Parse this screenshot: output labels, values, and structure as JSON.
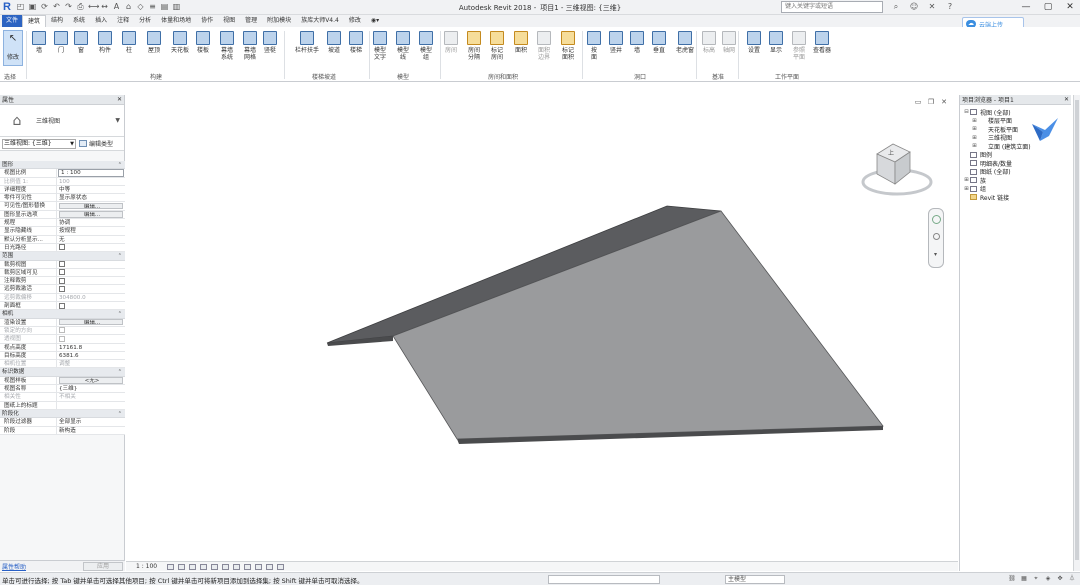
{
  "titlebar": {
    "logo": "R",
    "app": "Autodesk Revit 2018 -",
    "project": "项目1 - 三维视图: {三维}",
    "search_placeholder": "键入关键字或短语"
  },
  "tabs": [
    "文件",
    "建筑",
    "结构",
    "系统",
    "插入",
    "注释",
    "分析",
    "体量和场地",
    "协作",
    "视图",
    "管理",
    "附加模块",
    "族库大师V4.4",
    "修改"
  ],
  "cloud_button": "云端上传",
  "ribbon": {
    "modify": "修改",
    "select_label": "选择",
    "build_panel": "构建",
    "stair_panel": "楼梯坡道",
    "model_panel": "模型",
    "room_panel": "房间和面积",
    "opening_panel": "洞口",
    "datum_panel": "基准",
    "workplane_panel": "工作平面",
    "buttons": [
      {
        "label": "墙",
        "style": "blue"
      },
      {
        "label": "门",
        "style": "blue"
      },
      {
        "label": "窗",
        "style": "blue"
      },
      {
        "label": "构件",
        "style": "blue"
      },
      {
        "label": "柱",
        "style": "blue"
      },
      {
        "label": "屋顶",
        "style": "blue"
      },
      {
        "label": "天花板",
        "style": "blue"
      },
      {
        "label": "楼板",
        "style": "blue"
      },
      {
        "label": "幕墙\n系统",
        "style": "blue"
      },
      {
        "label": "幕墙\n网格",
        "style": "blue"
      },
      {
        "label": "竖梃",
        "style": "blue"
      },
      {
        "label": "栏杆扶手",
        "style": "blue"
      },
      {
        "label": "坡道",
        "style": "blue"
      },
      {
        "label": "楼梯",
        "style": "blue"
      },
      {
        "label": "模型\n文字",
        "style": "blue"
      },
      {
        "label": "模型\n线",
        "style": "blue"
      },
      {
        "label": "模型\n组",
        "style": "blue"
      },
      {
        "label": "房间",
        "style": "gray",
        "dim": true
      },
      {
        "label": "房间\n分隔",
        "style": "orange"
      },
      {
        "label": "标记\n房间",
        "style": "orange"
      },
      {
        "label": "面积",
        "style": "orange"
      },
      {
        "label": "面积\n边界",
        "style": "gray",
        "dim": true
      },
      {
        "label": "标记\n面积",
        "style": "orange"
      },
      {
        "label": "按\n面",
        "style": "blue"
      },
      {
        "label": "竖井",
        "style": "blue"
      },
      {
        "label": "墙",
        "style": "blue"
      },
      {
        "label": "垂直",
        "style": "blue"
      },
      {
        "label": "老虎窗",
        "style": "blue"
      },
      {
        "label": "标高",
        "style": "gray",
        "dim": true
      },
      {
        "label": "轴网",
        "style": "gray",
        "dim": true
      },
      {
        "label": "设置",
        "style": "blue"
      },
      {
        "label": "显示",
        "style": "blue"
      },
      {
        "label": "参照\n平面",
        "style": "gray",
        "dim": true
      },
      {
        "label": "查看器",
        "style": "blue"
      }
    ]
  },
  "properties": {
    "title": "属性",
    "close": "✕",
    "type_name": "三维视图",
    "view_selector": "三维视图: {三维}",
    "edit_type": "编辑类型",
    "groups": [
      {
        "name": "图形",
        "rows": [
          {
            "k": "视图比例",
            "v": "1 : 100",
            "kind": "input"
          },
          {
            "k": "比例值 1:",
            "v": "100",
            "dim": true
          },
          {
            "k": "详细程度",
            "v": "中等"
          },
          {
            "k": "零件可见性",
            "v": "显示原状态"
          },
          {
            "k": "可见性/图形替换",
            "v": "编辑...",
            "kind": "btn"
          },
          {
            "k": "图形显示选项",
            "v": "编辑...",
            "kind": "btn"
          },
          {
            "k": "规程",
            "v": "协调"
          },
          {
            "k": "显示隐藏线",
            "v": "按规程"
          },
          {
            "k": "默认分析显示...",
            "v": "无"
          },
          {
            "k": "日光路径",
            "v": "",
            "kind": "chk"
          }
        ]
      },
      {
        "name": "范围",
        "rows": [
          {
            "k": "裁剪视图",
            "v": "",
            "kind": "chk"
          },
          {
            "k": "裁剪区域可见",
            "v": "",
            "kind": "chk"
          },
          {
            "k": "注释裁剪",
            "v": "",
            "kind": "chk"
          },
          {
            "k": "远剪裁激活",
            "v": "",
            "kind": "chk"
          },
          {
            "k": "远剪裁偏移",
            "v": "304800.0",
            "dim": true
          },
          {
            "k": "剖面框",
            "v": "",
            "kind": "chk"
          }
        ]
      },
      {
        "name": "相机",
        "rows": [
          {
            "k": "渲染设置",
            "v": "编辑...",
            "kind": "btn"
          },
          {
            "k": "锁定的方向",
            "v": "",
            "kind": "chk",
            "dim": true
          },
          {
            "k": "透视图",
            "v": "",
            "kind": "chk",
            "dim": true
          },
          {
            "k": "视点高度",
            "v": "17161.8"
          },
          {
            "k": "目标高度",
            "v": "6381.6"
          },
          {
            "k": "相机位置",
            "v": "调整",
            "dim": true
          }
        ]
      },
      {
        "name": "标识数据",
        "rows": [
          {
            "k": "视图样板",
            "v": "<无>",
            "kind": "btn"
          },
          {
            "k": "视图名称",
            "v": "{三维}"
          },
          {
            "k": "相关性",
            "v": "不相关",
            "dim": true
          },
          {
            "k": "图纸上的标题",
            "v": ""
          }
        ]
      },
      {
        "name": "阶段化",
        "rows": [
          {
            "k": "阶段过滤器",
            "v": "全部显示"
          },
          {
            "k": "阶段",
            "v": "新构造"
          }
        ]
      }
    ],
    "help_link": "属性帮助",
    "apply": "应用"
  },
  "browser": {
    "title": "项目浏览器 - 项目1",
    "close": "✕",
    "tree": [
      {
        "label": "视图 (全部)",
        "level": 0,
        "toggle": "⊟",
        "icon": "v"
      },
      {
        "label": "楼层平面",
        "level": 1,
        "toggle": "⊞",
        "icon": ""
      },
      {
        "label": "天花板平面",
        "level": 1,
        "toggle": "⊞",
        "icon": ""
      },
      {
        "label": "三维视图",
        "level": 1,
        "toggle": "⊞",
        "icon": ""
      },
      {
        "label": "立面 (建筑立面)",
        "level": 1,
        "toggle": "⊞",
        "icon": ""
      },
      {
        "label": "图例",
        "level": 0,
        "toggle": "",
        "icon": "v"
      },
      {
        "label": "明细表/数量",
        "level": 0,
        "toggle": "",
        "icon": "v"
      },
      {
        "label": "图纸 (全部)",
        "level": 0,
        "toggle": "",
        "icon": "v"
      },
      {
        "label": "族",
        "level": 0,
        "toggle": "⊞",
        "icon": "v"
      },
      {
        "label": "组",
        "level": 0,
        "toggle": "⊞",
        "icon": "v"
      },
      {
        "label": "Revit 链接",
        "level": 0,
        "toggle": "",
        "icon": "r"
      }
    ]
  },
  "viewcube_face": "上",
  "viewbar": {
    "scale": "1 : 100"
  },
  "status": {
    "message": "单击可进行选择; 按 Tab 键并单击可选择其他项目; 按 Ctrl 键并单击可将新项目添加到选择集; 按 Shift 键并单击可取消选择。",
    "model_field": "",
    "workset": "主模型"
  },
  "colors": {
    "roof_top": "#5b5c5f",
    "roof_front": "#9a9b9d",
    "roof_edge": "#4a4b4d",
    "accent": "#2d64c2"
  }
}
